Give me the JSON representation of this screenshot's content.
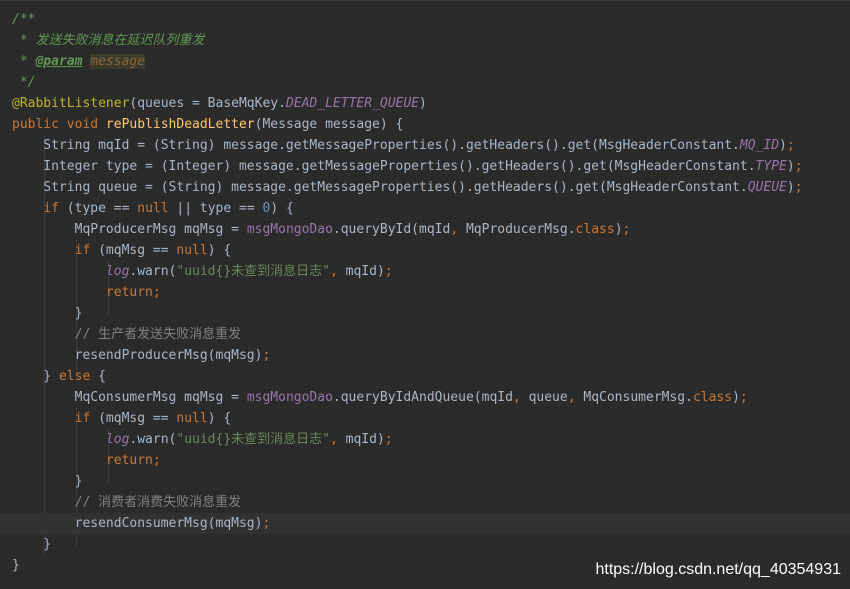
{
  "editor": {
    "lines": [
      [
        {
          "t": "/**",
          "c": "comment"
        }
      ],
      [
        {
          "t": " * 发送失败消息在延迟队列重发",
          "c": "comment"
        }
      ],
      [
        {
          "t": " * ",
          "c": "comment"
        },
        {
          "t": "@param",
          "c": "tag"
        },
        {
          "t": " ",
          "c": "comment"
        },
        {
          "t": "message",
          "c": "param"
        }
      ],
      [
        {
          "t": " */",
          "c": "comment"
        }
      ],
      [
        {
          "t": "@RabbitListener",
          "c": "anno"
        },
        {
          "t": "(queues = BaseMqKey."
        },
        {
          "t": "DEAD_LETTER_QUEUE",
          "c": "const"
        },
        {
          "t": ")"
        }
      ],
      [
        {
          "t": "public void ",
          "c": "kw"
        },
        {
          "t": "rePublishDeadLetter",
          "c": "fn"
        },
        {
          "t": "(Message message) {"
        }
      ],
      [
        {
          "t": "    String mqId = (String) message.getMessageProperties().getHeaders().get(MsgHeaderConstant."
        },
        {
          "t": "MQ_ID",
          "c": "const"
        },
        {
          "t": ")"
        },
        {
          "t": ";",
          "c": "kw"
        }
      ],
      [
        {
          "t": "    Integer type = (Integer) message.getMessageProperties().getHeaders().get(MsgHeaderConstant."
        },
        {
          "t": "TYPE",
          "c": "const"
        },
        {
          "t": ")"
        },
        {
          "t": ";",
          "c": "kw"
        }
      ],
      [
        {
          "t": "    String queue = (String) message.getMessageProperties().getHeaders().get(MsgHeaderConstant."
        },
        {
          "t": "QUEUE",
          "c": "const"
        },
        {
          "t": ")"
        },
        {
          "t": ";",
          "c": "kw"
        }
      ],
      [
        {
          "t": "    "
        },
        {
          "t": "if ",
          "c": "kw"
        },
        {
          "t": "(type == "
        },
        {
          "t": "null ",
          "c": "kw"
        },
        {
          "t": "|| type == "
        },
        {
          "t": "0",
          "c": "num"
        },
        {
          "t": ") {"
        }
      ],
      [
        {
          "t": "        MqProducerMsg mqMsg = "
        },
        {
          "t": "msgMongoDao",
          "c": "field"
        },
        {
          "t": ".queryById(mqId"
        },
        {
          "t": ", ",
          "c": "kw"
        },
        {
          "t": "MqProducerMsg."
        },
        {
          "t": "class",
          "c": "kw"
        },
        {
          "t": ")"
        },
        {
          "t": ";",
          "c": "kw"
        }
      ],
      [
        {
          "t": "        "
        },
        {
          "t": "if ",
          "c": "kw"
        },
        {
          "t": "(mqMsg == "
        },
        {
          "t": "null",
          "c": "kw"
        },
        {
          "t": ") {"
        }
      ],
      [
        {
          "t": "            "
        },
        {
          "t": "log",
          "c": "const"
        },
        {
          "t": ".warn("
        },
        {
          "t": "\"uuid{}未查到消息日志\"",
          "c": "str"
        },
        {
          "t": ", ",
          "c": "kw"
        },
        {
          "t": "mqId)"
        },
        {
          "t": ";",
          "c": "kw"
        }
      ],
      [
        {
          "t": "            "
        },
        {
          "t": "return;",
          "c": "kw"
        }
      ],
      [
        {
          "t": "        }"
        }
      ],
      [
        {
          "t": "        // 生产者发送失败消息重发",
          "c": "gray"
        }
      ],
      [
        {
          "t": "        resendProducerMsg(mqMsg)"
        },
        {
          "t": ";",
          "c": "kw"
        }
      ],
      [
        {
          "t": "    } "
        },
        {
          "t": "else ",
          "c": "kw"
        },
        {
          "t": "{"
        }
      ],
      [
        {
          "t": "        MqConsumerMsg mqMsg = "
        },
        {
          "t": "msgMongoDao",
          "c": "field"
        },
        {
          "t": ".queryByIdAndQueue(mqId"
        },
        {
          "t": ", ",
          "c": "kw"
        },
        {
          "t": "queue"
        },
        {
          "t": ", ",
          "c": "kw"
        },
        {
          "t": "MqConsumerMsg."
        },
        {
          "t": "class",
          "c": "kw"
        },
        {
          "t": ")"
        },
        {
          "t": ";",
          "c": "kw"
        }
      ],
      [
        {
          "t": "        "
        },
        {
          "t": "if ",
          "c": "kw"
        },
        {
          "t": "(mqMsg == "
        },
        {
          "t": "null",
          "c": "kw"
        },
        {
          "t": ") {"
        }
      ],
      [
        {
          "t": "            "
        },
        {
          "t": "log",
          "c": "const"
        },
        {
          "t": ".warn("
        },
        {
          "t": "\"uuid{}未查到消息日志\"",
          "c": "str"
        },
        {
          "t": ", ",
          "c": "kw"
        },
        {
          "t": "mqId)"
        },
        {
          "t": ";",
          "c": "kw"
        }
      ],
      [
        {
          "t": "            "
        },
        {
          "t": "return;",
          "c": "kw"
        }
      ],
      [
        {
          "t": "        }"
        }
      ],
      [
        {
          "t": "        // 消费者消费失败消息重发",
          "c": "gray"
        }
      ],
      [
        {
          "t": "        resendConsumerMsg(mqMsg)"
        },
        {
          "t": ";",
          "c": "kw"
        }
      ],
      [
        {
          "t": "    }"
        }
      ],
      [
        {
          "t": "}"
        }
      ]
    ],
    "caret_line": 24
  },
  "watermark": "https://blog.csdn.net/qq_40354931",
  "colors": {
    "background": "#2b2b2b",
    "keyword": "#cc7832",
    "method": "#ffc66d",
    "string": "#6a8759",
    "comment": "#629755",
    "constant": "#9876aa",
    "number": "#6897bb"
  }
}
